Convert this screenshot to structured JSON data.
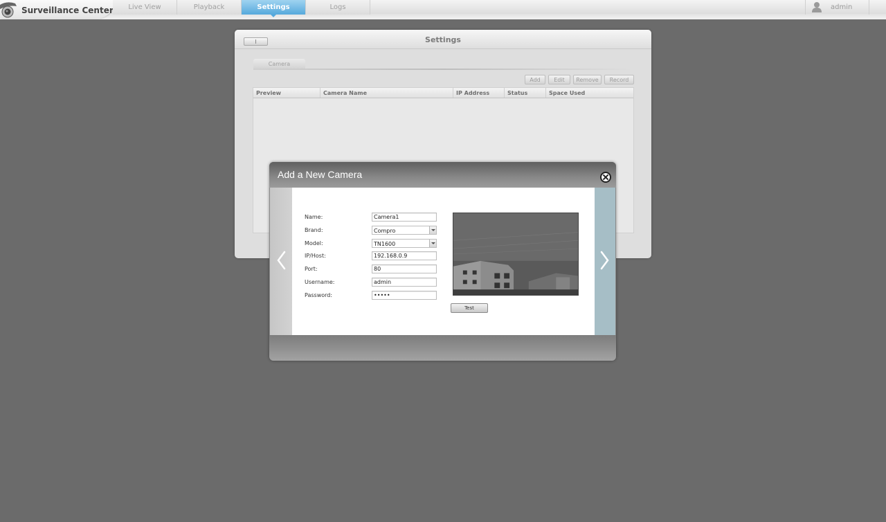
{
  "app": {
    "title": "Surveillance Center",
    "user": "admin"
  },
  "nav": {
    "tabs": [
      {
        "label": "Live View",
        "active": false
      },
      {
        "label": "Playback",
        "active": false
      },
      {
        "label": "Settings",
        "active": true
      },
      {
        "label": "Logs",
        "active": false
      }
    ]
  },
  "settings": {
    "title": "Settings",
    "active_tab": "Camera",
    "toolbar": {
      "add_label": "Add",
      "edit_label": "Edit",
      "remove_label": "Remove",
      "record_label": "Record"
    },
    "table": {
      "columns": [
        "Preview",
        "Camera Name",
        "IP Address",
        "Status",
        "Space Used"
      ],
      "rows": []
    }
  },
  "dialog": {
    "title": "Add a New Camera",
    "form": {
      "name_label": "Name:",
      "name_value": "Camera1",
      "brand_label": "Brand:",
      "brand_value": "Compro",
      "model_label": "Model:",
      "model_value": "TN1600",
      "ip_label": "IP/Host:",
      "ip_value": "192.168.0.9",
      "port_label": "Port:",
      "port_value": "80",
      "username_label": "Username:",
      "username_value": "admin",
      "password_label": "Password:",
      "password_value": "•••••"
    },
    "test_label": "Test"
  },
  "colors": {
    "accent": "#56a9dc",
    "background": "#6b6b6b"
  }
}
